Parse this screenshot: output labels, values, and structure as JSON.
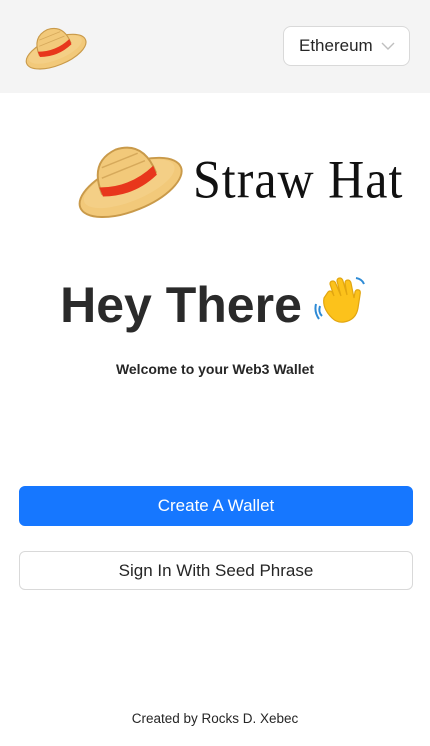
{
  "header": {
    "network_select": {
      "value": "Ethereum"
    }
  },
  "brand": {
    "name": "Straw Hat"
  },
  "hero": {
    "title": "Hey There",
    "emoji": "👋",
    "subtitle": "Welcome to your Web3 Wallet"
  },
  "actions": {
    "create_wallet": "Create A Wallet",
    "sign_in_seed": "Sign In With Seed Phrase"
  },
  "footer": {
    "credit": "Created by Rocks D. Xebec"
  },
  "colors": {
    "primary": "#1677ff",
    "header_bg": "#f4f4f4",
    "hat_straw": "#f2c97a",
    "hat_band": "#e8361c"
  }
}
